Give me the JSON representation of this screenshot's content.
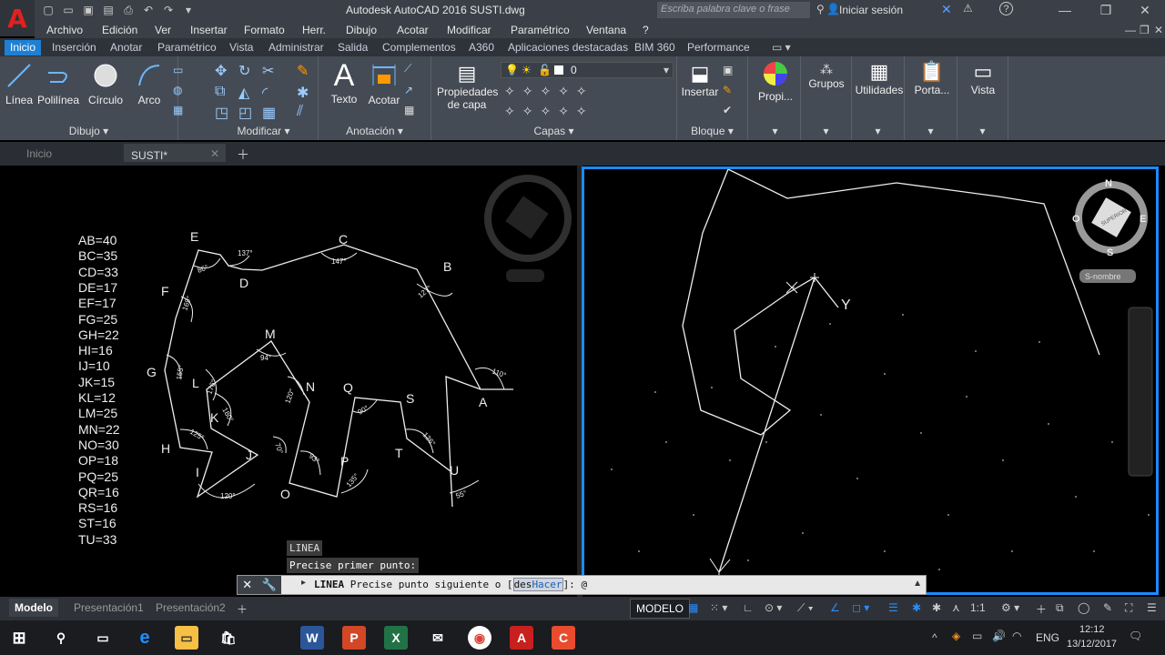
{
  "window": {
    "title": "Autodesk AutoCAD 2016    SUSTI.dwg",
    "search_placeholder": "Escriba palabra clave o frase",
    "signin": "Iniciar sesión",
    "logo": "A"
  },
  "menu": [
    "Archivo",
    "Edición",
    "Ver",
    "Insertar",
    "Formato",
    "Herr.",
    "Dibujo",
    "Acotar",
    "Modificar",
    "Paramétrico",
    "Ventana",
    "?"
  ],
  "ribbon_tabs": [
    "Inicio",
    "Inserción",
    "Anotar",
    "Paramétrico",
    "Vista",
    "Administrar",
    "Salida",
    "Complementos",
    "A360",
    "Aplicaciones destacadas",
    "BIM 360",
    "Performance"
  ],
  "ribbon": {
    "draw": {
      "title": "Dibujo",
      "line": "Línea",
      "polyline": "Polilínea",
      "circle": "Círculo",
      "arc": "Arco"
    },
    "modify": {
      "title": "Modificar"
    },
    "annotation": {
      "title": "Anotación",
      "text": "Texto",
      "dimension": "Acotar"
    },
    "layers": {
      "title": "Capas",
      "layer_props_1": "Propiedades",
      "layer_props_2": "de capa",
      "current_layer": "0"
    },
    "block": {
      "title": "Bloque",
      "insert": "Insertar"
    },
    "props": "Propi...",
    "groups": "Grupos",
    "utilities": "Utilidades",
    "clipboard": "Porta...",
    "view": "Vista"
  },
  "doc_tabs": {
    "home": "Inicio",
    "file": "SUSTI*"
  },
  "lengths": [
    "AB=40",
    "BC=35",
    "CD=33",
    "DE=17",
    "EF=17",
    "FG=25",
    "GH=22",
    "HI=16",
    "IJ=10",
    "JK=15",
    "KL=12",
    "LM=25",
    "MN=22",
    "NO=30",
    "OP=18",
    "PQ=25",
    "QR=16",
    "RS=16",
    "ST=16",
    "TU=33"
  ],
  "points": {
    "A": "A",
    "B": "B",
    "C": "C",
    "D": "D",
    "E": "E",
    "F": "F",
    "G": "G",
    "H": "H",
    "I": "I",
    "J": "J",
    "K": "K",
    "L": "L",
    "M": "M",
    "N": "N",
    "O": "O",
    "P": "P",
    "Q": "Q",
    "S": "S",
    "T": "T",
    "U": "U"
  },
  "angles": [
    "137°",
    "147°",
    "127°",
    "110°",
    "86°",
    "169°",
    "155°",
    "125°",
    "120°",
    "70°",
    "94°",
    "120°",
    "93°",
    "135°",
    "90°",
    "126°",
    "55°",
    "176°",
    "180°"
  ],
  "viewcube": {
    "n": "N",
    "s": "S",
    "e": "E",
    "o": "O",
    "face": "SUPERIOR",
    "wcs": "S-nombre"
  },
  "ucs_y": "Y",
  "command": {
    "history1": "LINEA",
    "history2": "Precise primer punto:",
    "cmd": "LINEA",
    "prompt": "Precise punto siguiente o [",
    "option_pre": "des",
    "option_key": "Hacer",
    "prompt_end": "]: ",
    "input": "@"
  },
  "layout_tabs": [
    "Modelo",
    "Presentación1",
    "Presentación2"
  ],
  "status": {
    "model": "MODELO",
    "scale": "1:1"
  },
  "taskbar": {
    "lang": "ENG",
    "time": "12:12",
    "date": "13/12/2017"
  }
}
